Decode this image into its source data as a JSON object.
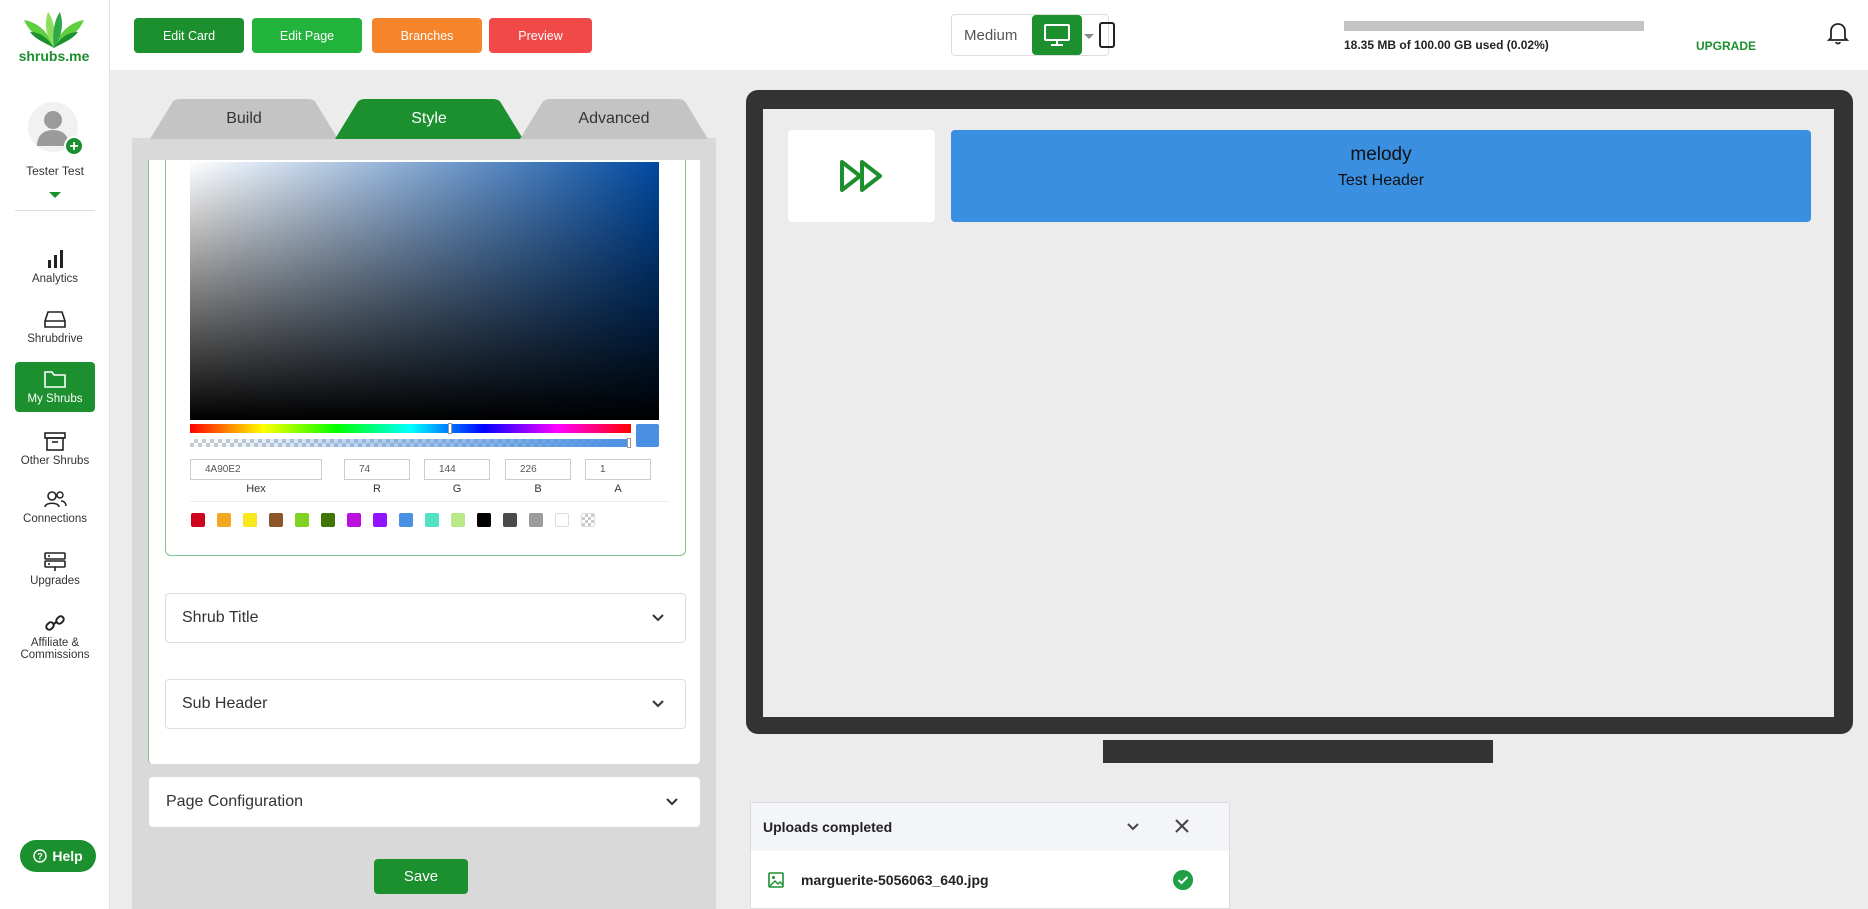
{
  "brand": {
    "logo_text": "shrubs.me",
    "accent": "#1c8f2e"
  },
  "user": {
    "name": "Tester Test"
  },
  "sidebar": {
    "items": [
      {
        "label": "Analytics",
        "icon": "bar-chart-icon"
      },
      {
        "label": "Shrubdrive",
        "icon": "drive-icon"
      },
      {
        "label": "My Shrubs",
        "icon": "folder-icon"
      },
      {
        "label": "Other Shrubs",
        "icon": "archive-icon"
      },
      {
        "label": "Connections",
        "icon": "users-icon"
      },
      {
        "label": "Upgrades",
        "icon": "server-icon"
      },
      {
        "label": "Affiliate & Commissions",
        "icon": "link-icon"
      }
    ],
    "help_label": "Help"
  },
  "toolbar": {
    "edit_card": "Edit Card",
    "edit_page": "Edit Page",
    "branches": "Branches",
    "preview": "Preview",
    "size_value": "Medium",
    "storage_text": "18.35 MB of 100.00 GB used (0.02%)",
    "storage_used_fraction": 0.0002,
    "upgrade_label": "UPGRADE"
  },
  "tabs": [
    {
      "label": "Build"
    },
    {
      "label": "Style"
    },
    {
      "label": "Advanced"
    }
  ],
  "color_picker": {
    "hex": "4A90E2",
    "r": "74",
    "g": "144",
    "b": "226",
    "a": "1",
    "labels": {
      "hex": "Hex",
      "r": "R",
      "g": "G",
      "b": "B",
      "a": "A"
    },
    "presets": [
      "#d0021b",
      "#f5a623",
      "#f8e71c",
      "#8b572a",
      "#7ed321",
      "#417505",
      "#bd10e0",
      "#9013fe",
      "#4a90e2",
      "#50e3c2",
      "#b8e986",
      "#000000",
      "#4a4a4a",
      "#9b9b9b",
      "#ffffff",
      "transparent"
    ]
  },
  "accordions": {
    "shrub_title": "Shrub Title",
    "sub_header": "Sub Header",
    "page_configuration": "Page Configuration"
  },
  "save_label": "Save",
  "preview": {
    "card_title": "melody",
    "card_subtitle": "Test Header",
    "card_color": "#3b8fe0"
  },
  "uploads": {
    "title": "Uploads completed",
    "files": [
      {
        "name": "marguerite-5056063_640.jpg",
        "status": "done"
      }
    ]
  }
}
